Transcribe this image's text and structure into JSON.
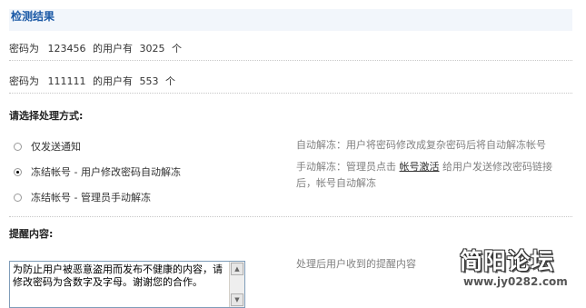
{
  "results": {
    "title": "检测结果",
    "lines": [
      {
        "prefix": "密码为",
        "password": "123456",
        "middle": "的用户有",
        "count": "3025",
        "unit": "个"
      },
      {
        "prefix": "密码为",
        "password": "111111",
        "middle": "的用户有",
        "count": "553",
        "unit": "个"
      }
    ]
  },
  "handling": {
    "label": "请选择处理方式:",
    "options": [
      {
        "label": "仅发送通知",
        "checked": false
      },
      {
        "label": "冻结帐号 - 用户修改密码自动解冻",
        "checked": true
      },
      {
        "label": "冻结帐号 - 管理员手动解冻",
        "checked": false
      }
    ],
    "help": {
      "auto": "自动解冻：用户将密码修改成复杂密码后将自动解冻帐号",
      "manual_prefix": "手动解冻：管理员点击",
      "manual_link": "帐号激活",
      "manual_suffix": "给用户发送修改密码链接",
      "manual_line2": "后，帐号自动解冻"
    }
  },
  "reminder": {
    "label": "提醒内容:",
    "text": "为防止用户被恶意盗用而发布不健康的内容，请修改密码为含数字及字母。谢谢您的合作。",
    "hint": "处理后用户收到的提醒内容"
  },
  "watermark": {
    "main": "简阳论坛",
    "url": "www.jy0282.com"
  },
  "colors": {
    "title_blue": "#1c5aa6",
    "title_bg": "#f2f6fb",
    "muted_gray": "#808080"
  }
}
